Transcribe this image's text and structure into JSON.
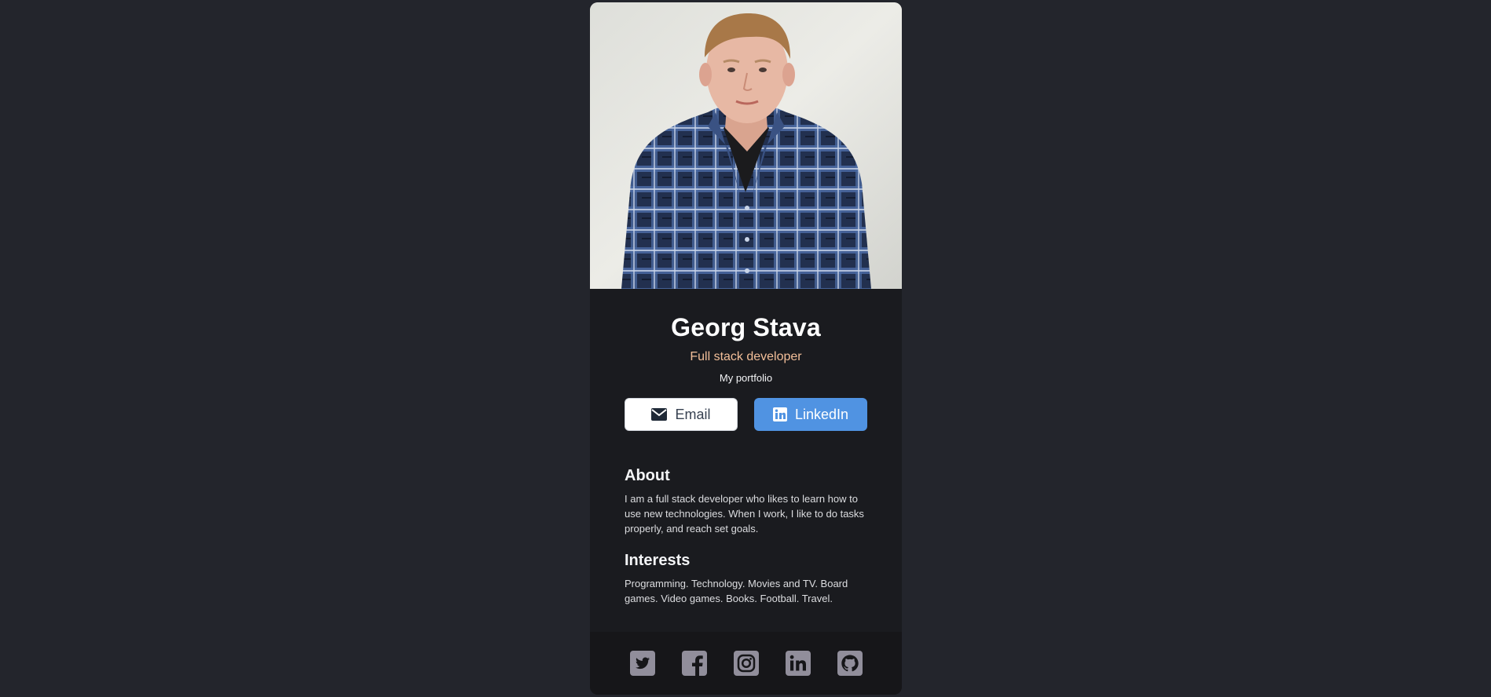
{
  "profile": {
    "name": "Georg Stava",
    "title": "Full stack developer",
    "portfolio_link": "My portfolio",
    "photo_icon": "portrait-photo"
  },
  "buttons": {
    "email_label": "Email",
    "email_icon": "envelope-icon",
    "linkedin_label": "LinkedIn",
    "linkedin_icon": "linkedin-icon"
  },
  "about": {
    "heading": "About",
    "text": "I am a full stack developer who likes to learn how to use new technologies. When I work, I like to do tasks properly, and reach set goals."
  },
  "interests": {
    "heading": "Interests",
    "text": "Programming. Technology. Movies and TV. Board games. Video games. Books. Football. Travel."
  },
  "footer": {
    "icons": [
      "twitter-icon",
      "facebook-icon",
      "instagram-icon",
      "linkedin-icon",
      "github-icon"
    ]
  },
  "colors": {
    "page_background": "#23252c",
    "card_background": "#1a1b1f",
    "footer_background": "#161619",
    "accent_title": "#f3bf99",
    "linkedin_button": "#5093e2",
    "social_icon": "#918e9b"
  }
}
